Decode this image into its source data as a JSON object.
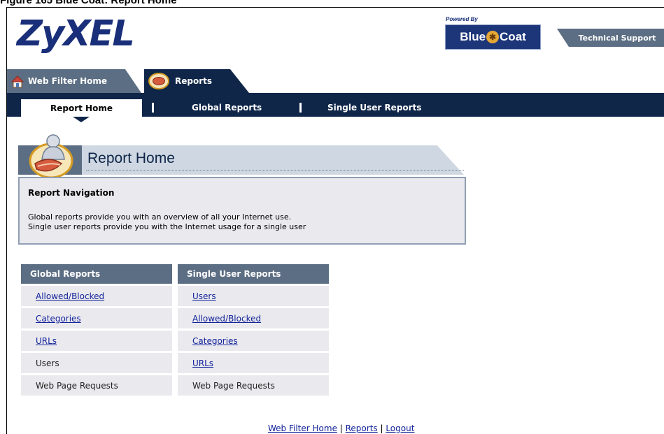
{
  "caption": "Figure 165   Blue Coat: Report Home",
  "header": {
    "logo": "ZyXEL",
    "powered_by": "Powered By",
    "bluecoat_left": "Blue",
    "bluecoat_right": "Coat",
    "tech_support": "Technical Support"
  },
  "tabs": {
    "web_filter_home": "Web Filter Home",
    "reports": "Reports"
  },
  "subtabs": {
    "report_home": "Report Home",
    "global_reports": "Global Reports",
    "single_user_reports": "Single User Reports"
  },
  "banner": {
    "title": "Report Home"
  },
  "navigation": {
    "heading": "Report Navigation",
    "line1": "Global reports provide you with an overview of all your Internet use.",
    "line2": "Single user reports provide you with the Internet usage for a single user"
  },
  "global_reports": {
    "heading": "Global Reports",
    "items": [
      "Allowed/Blocked",
      "Categories",
      "URLs",
      "Users",
      "Web Page Requests"
    ]
  },
  "single_user_reports": {
    "heading": "Single User Reports",
    "items": [
      "Users",
      "Allowed/Blocked",
      "Categories",
      "URLs",
      "Web Page Requests"
    ]
  },
  "footer": {
    "web_filter_home": "Web Filter Home",
    "sep1": " | ",
    "reports": "Reports",
    "sep2": " | ",
    "logout": "Logout"
  },
  "colors": {
    "navy": "#0f2649",
    "slate": "#5c6e84",
    "panel": "#eae9ee",
    "link": "#12239a"
  }
}
